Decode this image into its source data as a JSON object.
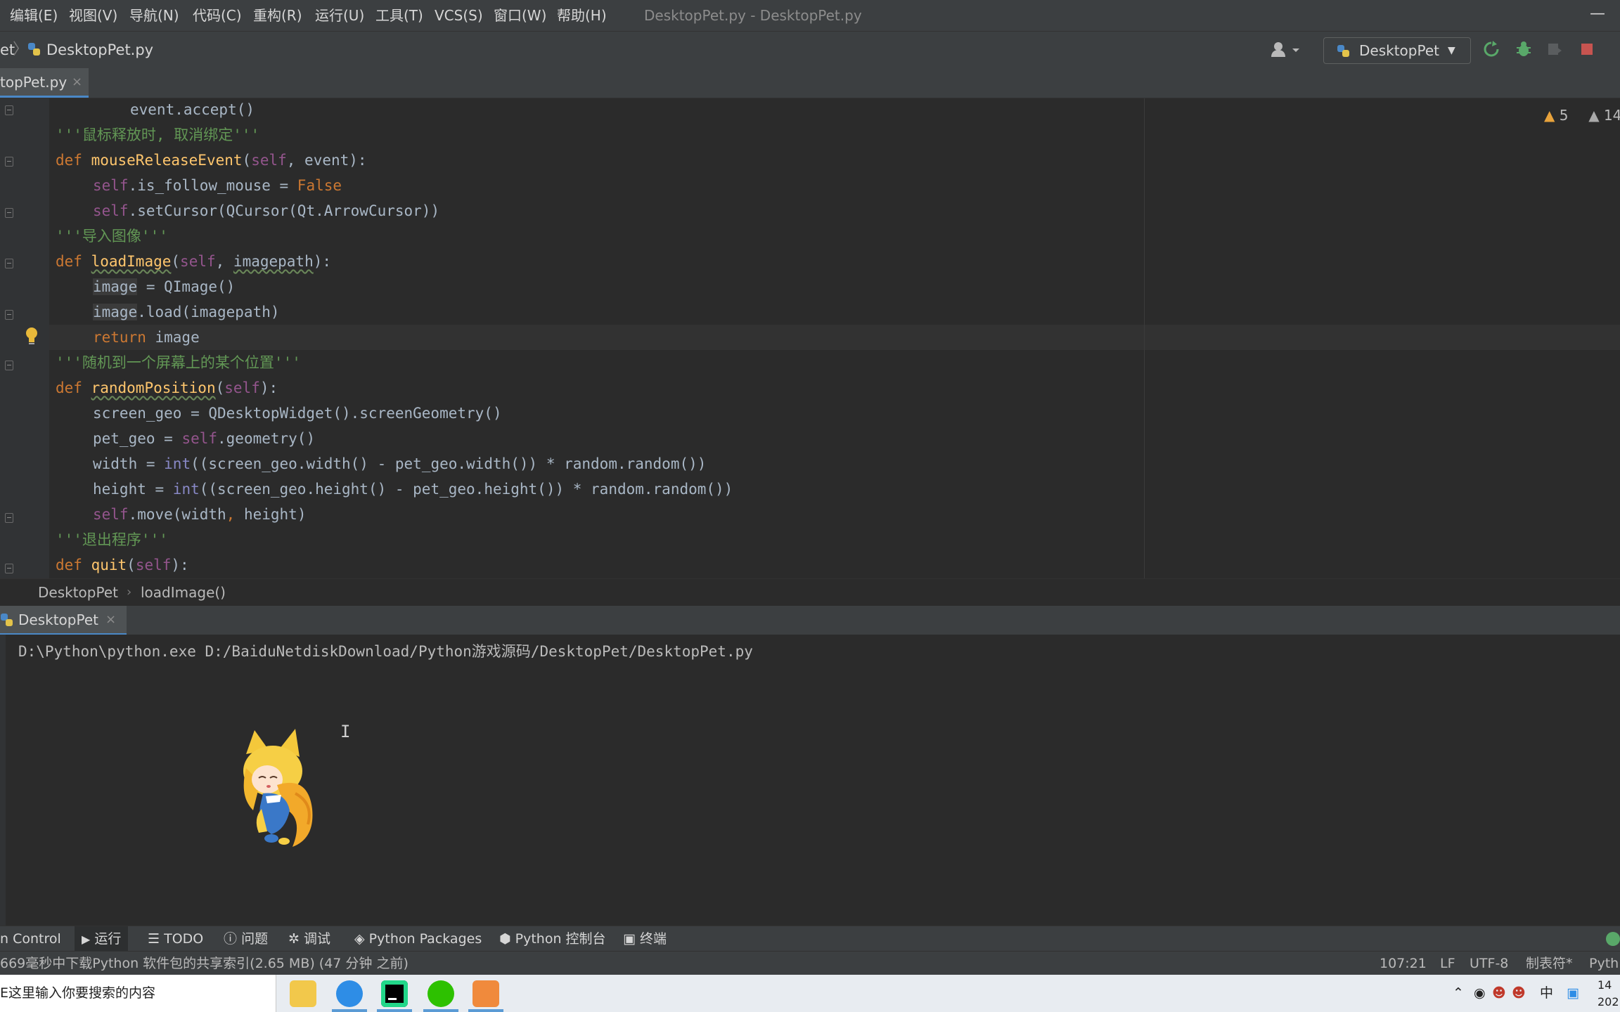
{
  "menu": {
    "items": [
      "编辑(E)",
      "视图(V)",
      "导航(N)",
      "代码(C)",
      "重构(R)",
      "运行(U)",
      "工具(T)",
      "VCS(S)",
      "窗口(W)",
      "帮助(H)"
    ],
    "window_title": "DesktopPet.py - DesktopPet.py",
    "minimize": "—"
  },
  "nav": {
    "project": "et",
    "file": "DesktopPet.py",
    "run_config": "DesktopPet"
  },
  "tabs": {
    "file_tab": "topPet.py",
    "close": "×"
  },
  "editor": {
    "inspections": {
      "warnings": "5",
      "weak_warnings": "14"
    },
    "lines": {
      "l0": {
        "c1": "event.accept()"
      },
      "l1": {
        "c1": "'''鼠标释放时, 取消绑定'''"
      },
      "l2": {
        "c1": "def",
        "c2": "mouseReleaseEvent",
        "c3": "(",
        "c4": "self",
        "c5": ", event):"
      },
      "l3": {
        "c1": "self",
        "c2": ".is_follow_mouse = ",
        "c3": "False"
      },
      "l4": {
        "c1": "self",
        "c2": ".setCursor(QCursor(Qt.ArrowCursor))"
      },
      "l5": {
        "c1": "'''导入图像'''"
      },
      "l6": {
        "c1": "def",
        "c2": "loadImage",
        "c3": "(",
        "c4": "self",
        "c5": ", ",
        "c6": "imagepath",
        "c7": "):"
      },
      "l7": {
        "c1": "image",
        "c2": " = QImage()"
      },
      "l8": {
        "c1": "image",
        "c2": ".load(imagepath)"
      },
      "l9": {
        "c1": "return",
        "c2": " image"
      },
      "l10": {
        "c1": "'''随机到一个屏幕上的某个位置'''"
      },
      "l11": {
        "c1": "def",
        "c2": "randomPosition",
        "c3": "(",
        "c4": "self",
        "c5": "):"
      },
      "l12": {
        "c1": "screen_geo = QDesktopWidget().screenGeometry()"
      },
      "l13": {
        "c1": "pet_geo = ",
        "c2": "self",
        "c3": ".geometry()"
      },
      "l14": {
        "c1": "width = ",
        "c2": "int",
        "c3": "((screen_geo.width() - pet_geo.width()) * random.random())"
      },
      "l15": {
        "c1": "height = ",
        "c2": "int",
        "c3": "((screen_geo.height() - pet_geo.height()) * random.random())"
      },
      "l16": {
        "c1": "self",
        "c2": ".move(width",
        "c3": ",",
        "c4": " height)"
      },
      "l17": {
        "c1": "'''退出程序'''"
      },
      "l18": {
        "c1": "def",
        "c2": "quit",
        "c3": "(",
        "c4": "self",
        "c5": "):"
      }
    }
  },
  "breadcrumbs": {
    "cls": "DesktopPet",
    "method": "loadImage()"
  },
  "run_panel": {
    "tab": "DesktopPet",
    "console_line": "D:\\Python\\python.exe D:/BaiduNetdiskDownload/Python游戏源码/DesktopPet/DesktopPet.py"
  },
  "tool_windows": [
    "n Control",
    "运行",
    "TODO",
    "问题",
    "调试",
    "Python Packages",
    "Python 控制台",
    "终端"
  ],
  "status": {
    "message": "669毫秒中下载Python 软件包的共享索引(2.65 MB) (47 分钟 之前)",
    "position": "107:21",
    "line_sep": "LF",
    "encoding": "UTF-8",
    "indent": "制表符*",
    "interpreter": "Pyth"
  },
  "taskbar": {
    "search_placeholder": "E这里输入你要搜索的内容",
    "ime": "中",
    "clock_time": "14",
    "clock_date": "202"
  },
  "colors": {
    "keyword": "#cc7832",
    "function": "#ffc66d",
    "self": "#94558d",
    "docstring": "#629755",
    "text": "#a9b7c6",
    "accent": "#4a88c7"
  }
}
